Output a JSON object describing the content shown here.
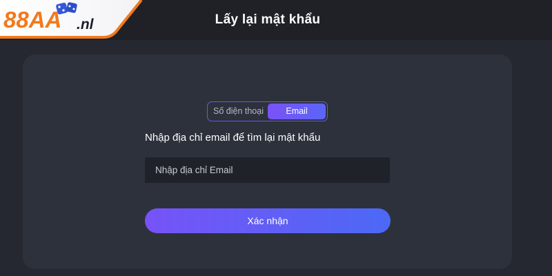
{
  "header": {
    "logo_number": "88AA",
    "logo_suffix": ".nl",
    "title": "Lấy lại mật khẩu"
  },
  "recovery": {
    "tabs": [
      {
        "label": "Số điện thoại",
        "active": false
      },
      {
        "label": "Email",
        "active": true
      }
    ],
    "instruction": "Nhập địa chỉ email để tìm lại mật khẩu",
    "email_placeholder": "Nhập địa chỉ Email",
    "email_value": "",
    "submit_label": "Xác nhận"
  },
  "colors": {
    "background": "#252830",
    "topbar": "#1f2127",
    "card": "#2d313b",
    "input_background": "#1f2229",
    "accent_purple": "#7753f7",
    "accent_blue": "#4c69f6",
    "logo_orange": "#f27a1d",
    "text_primary": "#ffffff"
  },
  "icons": [
    "dice-icon"
  ]
}
